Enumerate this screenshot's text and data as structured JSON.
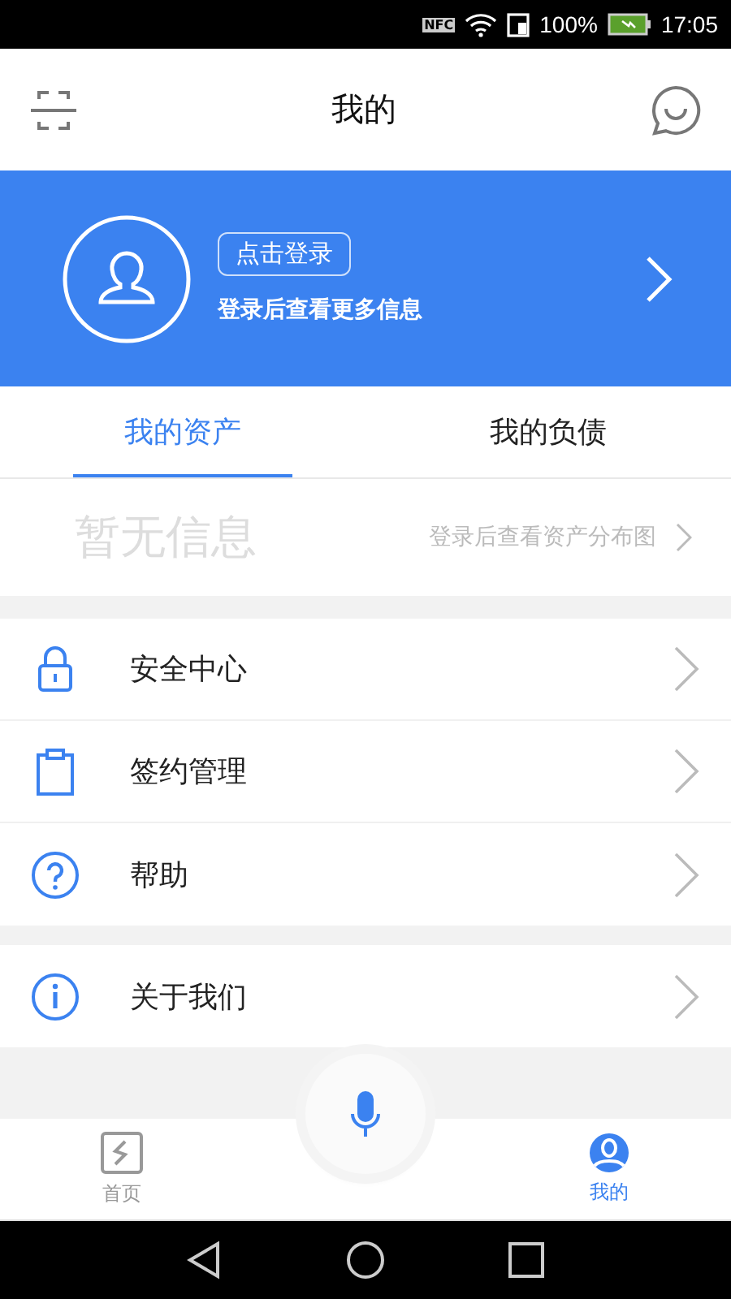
{
  "status_bar": {
    "nfc": "NFC",
    "battery": "100%",
    "time": "17:05"
  },
  "header": {
    "title": "我的"
  },
  "profile": {
    "login_button": "点击登录",
    "subtitle": "登录后查看更多信息"
  },
  "tabs": [
    {
      "label": "我的资产",
      "selected": true
    },
    {
      "label": "我的负债",
      "selected": false
    }
  ],
  "assets": {
    "empty": "暂无信息",
    "link": "登录后查看资产分布图"
  },
  "menu_groups": [
    [
      {
        "kind": "lock",
        "label": "安全中心"
      },
      {
        "kind": "clipboard",
        "label": "签约管理"
      },
      {
        "kind": "help",
        "label": "帮助"
      }
    ],
    [
      {
        "kind": "info",
        "label": "关于我们"
      }
    ]
  ],
  "bottom_nav": [
    {
      "kind": "home",
      "label": "首页",
      "selected": false
    },
    {
      "kind": "mine",
      "label": "我的",
      "selected": true
    }
  ]
}
